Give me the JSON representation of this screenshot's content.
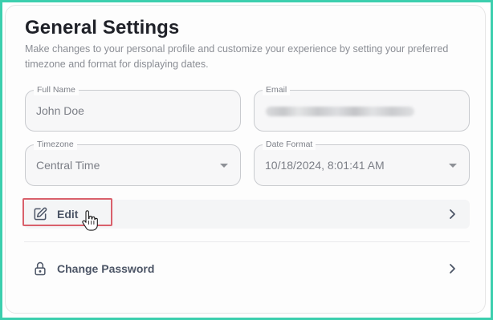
{
  "settings": {
    "title": "General Settings",
    "description": "Make changes to your personal profile and customize your experience by setting your preferred timezone and format for displaying dates."
  },
  "fields": {
    "full_name": {
      "label": "Full Name",
      "value": "John Doe"
    },
    "email": {
      "label": "Email",
      "value": ""
    },
    "timezone": {
      "label": "Timezone",
      "value": "Central Time"
    },
    "date_format": {
      "label": "Date Format",
      "value": "10/18/2024, 8:01:41 AM"
    }
  },
  "actions": {
    "edit_label": "Edit",
    "change_password_label": "Change Password"
  },
  "colors": {
    "frame": "#3ccfae",
    "highlight": "#d9606b",
    "title": "#1f2128"
  },
  "icons": {
    "edit": "pencil-icon",
    "password": "lock-icon",
    "chevron": "chevron-right-icon",
    "cursor": "hand-pointer-icon"
  }
}
